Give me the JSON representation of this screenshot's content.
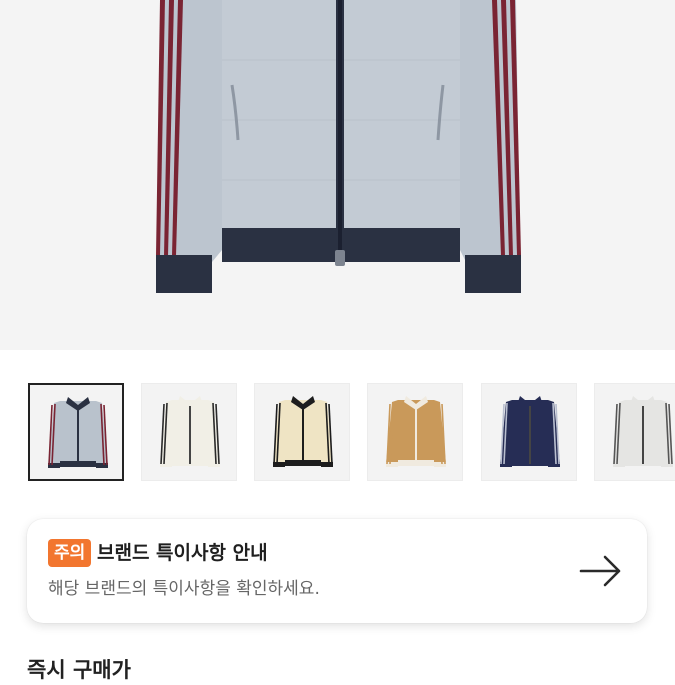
{
  "product": {
    "main_image": "track-jacket-light-blue-main-image",
    "thumbnails": [
      {
        "name": "light-blue-jacket",
        "body": "#b9c2cc",
        "trim": "#2a3142",
        "stripe": "#7a2433",
        "selected": true
      },
      {
        "name": "off-white-jacket",
        "body": "#f1efe6",
        "trim": "#f1efe6",
        "stripe": "#2a2a2a",
        "selected": false
      },
      {
        "name": "cream-black-jacket",
        "body": "#efe4c4",
        "trim": "#1d1d1d",
        "stripe": "#1d1d1d",
        "selected": false
      },
      {
        "name": "tan-jacket",
        "body": "#c9995a",
        "trim": "#f0eadf",
        "stripe": "#c9995a",
        "selected": false
      },
      {
        "name": "navy-jacket",
        "body": "#262d55",
        "trim": "#262d55",
        "stripe": "#b9bfd0",
        "selected": false
      },
      {
        "name": "grey-jacket",
        "body": "#e5e5e3",
        "trim": "#e5e5e3",
        "stripe": "#555",
        "selected": false
      }
    ]
  },
  "notice": {
    "badge": "주의",
    "title": "브랜드 특이사항 안내",
    "subtitle": "해당 브랜드의 특이사항을 확인하세요.",
    "arrow_icon": "arrow-right-icon"
  },
  "section": {
    "title": "즉시 구매가"
  },
  "colors": {
    "badge": "#f2762f",
    "hero_bg": "#f4f4f4"
  }
}
